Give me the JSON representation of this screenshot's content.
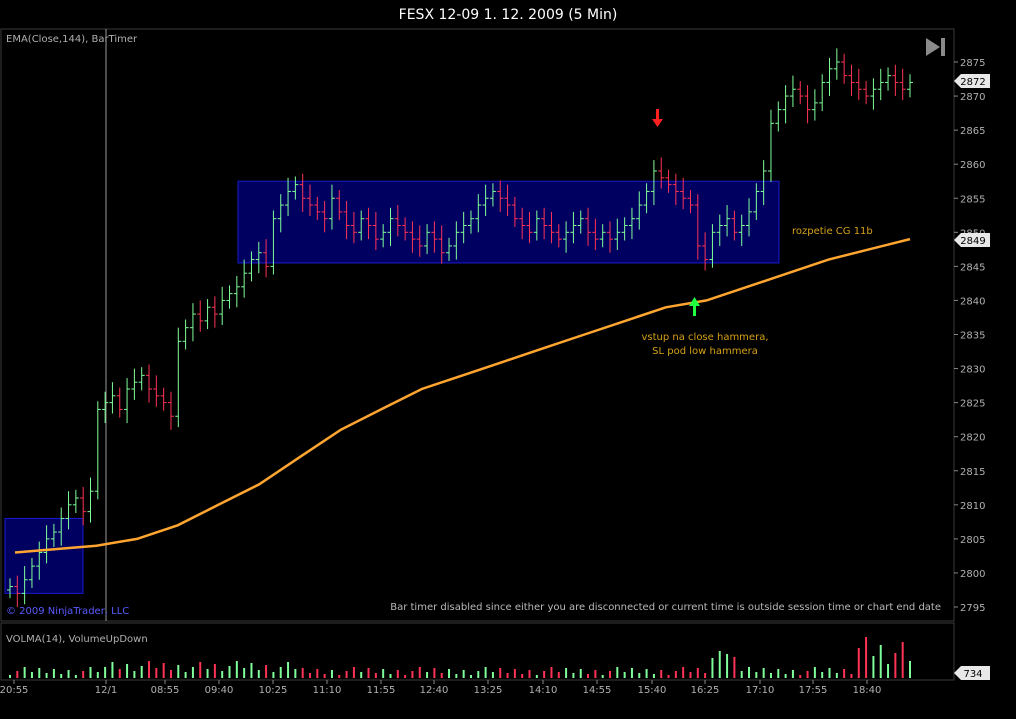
{
  "title": "FESX 12-09  1. 12. 2009 (5 Min)",
  "price_panel_label": "EMA(Close,144), BarTimer",
  "volume_panel_label": "VOLMA(14), VolumeUpDown",
  "copyright": "© 2009 NinjaTrader, LLC",
  "bar_timer_message": "Bar timer disabled since either you are disconnected or current time is outside session time or chart end date",
  "annotations": {
    "range_label": "rozpetie CG 11b",
    "entry_line1": "vstup na close hammera,",
    "entry_line2": "SL pod low hammera"
  },
  "price_badges": {
    "last_price": "2872",
    "ema_value": "2849",
    "volume_last": "734"
  },
  "x_ticks": [
    "20:55",
    "12/1",
    "08:55",
    "09:40",
    "10:25",
    "11:10",
    "11:55",
    "12:40",
    "13:25",
    "14:10",
    "14:55",
    "15:40",
    "16:25",
    "17:10",
    "17:55",
    "18:40"
  ],
  "colors": {
    "up": "#7fff9a",
    "down": "#ff3355",
    "ema": "#ffa530",
    "range_box": "#000060",
    "range_border": "#1a1acc",
    "arrow_down": "#ff2020",
    "arrow_up": "#20ff40"
  },
  "chart_data": {
    "type": "ohlc",
    "title": "FESX 12-09  1. 12. 2009 (5 Min)",
    "y_ticks": [
      2795,
      2800,
      2805,
      2810,
      2815,
      2820,
      2825,
      2830,
      2835,
      2840,
      2845,
      2850,
      2855,
      2860,
      2865,
      2870,
      2875
    ],
    "ylim": [
      2792.5,
      2879
    ],
    "x_tick_labels": [
      "20:55",
      "12/1",
      "08:55",
      "09:40",
      "10:25",
      "11:10",
      "11:55",
      "12:40",
      "13:25",
      "14:10",
      "14:55",
      "15:40",
      "16:25",
      "17:10",
      "17:55",
      "18:40"
    ],
    "grid": false,
    "close_sequence": [
      2798,
      2797,
      2799,
      2801,
      2803,
      2805,
      2806,
      2808,
      2810,
      2811,
      2809,
      2812,
      2824,
      2825,
      2826,
      2824,
      2827,
      2828,
      2829,
      2827,
      2826,
      2825,
      2823,
      2834,
      2836,
      2838,
      2837,
      2839,
      2838,
      2840,
      2841,
      2842,
      2844,
      2846,
      2847,
      2845,
      2852,
      2854,
      2856,
      2857,
      2855,
      2854,
      2853,
      2852,
      2855,
      2853,
      2851,
      2850,
      2852,
      2851,
      2849,
      2850,
      2852,
      2851,
      2850,
      2849,
      2848,
      2850,
      2849,
      2847,
      2848,
      2850,
      2851,
      2852,
      2854,
      2855,
      2856,
      2855,
      2854,
      2852,
      2851,
      2850,
      2852,
      2851,
      2850,
      2849,
      2850,
      2851,
      2852,
      2850,
      2849,
      2850,
      2849,
      2850,
      2851,
      2852,
      2854,
      2856,
      2859,
      2858,
      2857,
      2856,
      2855,
      2854,
      2848,
      2846,
      2850,
      2851,
      2852,
      2850,
      2851,
      2853,
      2856,
      2859,
      2866,
      2868,
      2870,
      2871,
      2870,
      2868,
      2869,
      2872,
      2874,
      2875,
      2873,
      2872,
      2871,
      2870,
      2871,
      2872,
      2873,
      2872,
      2871,
      2872
    ],
    "ema_144": [
      2803,
      2803.5,
      2804,
      2805,
      2807,
      2810,
      2813,
      2817,
      2821,
      2824,
      2827,
      2829,
      2831,
      2833,
      2835,
      2837,
      2839,
      2840,
      2842,
      2844,
      2846,
      2847.5,
      2849
    ],
    "range_box": {
      "high": 2857.5,
      "low": 2845.5,
      "label": "rozpetie CG 11b"
    },
    "opening_box": {
      "high": 2808,
      "low": 2797
    },
    "last_price": 2872,
    "ema_last": 2849,
    "volume": {
      "indicator": "VOLMA(14), VolumeUpDown",
      "last": 734
    }
  }
}
